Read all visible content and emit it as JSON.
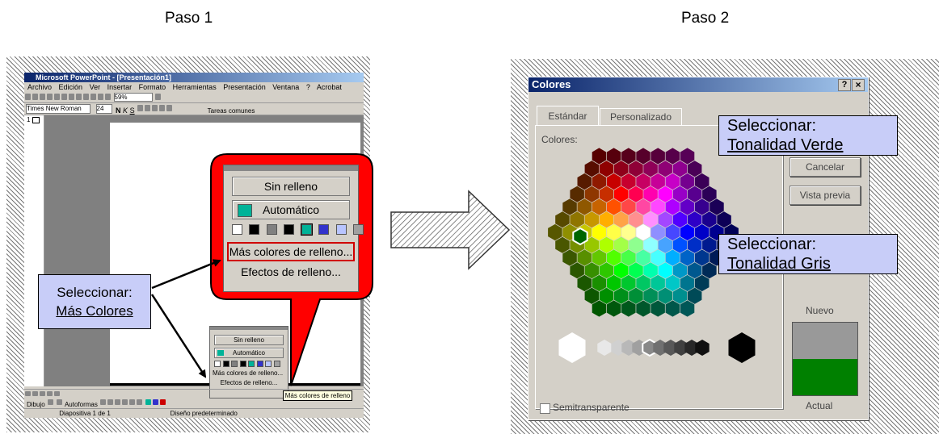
{
  "step1": {
    "heading": "Paso 1",
    "window_title": "Microsoft PowerPoint - [Presentación1]",
    "menu": [
      "Archivo",
      "Edición",
      "Ver",
      "Insertar",
      "Formato",
      "Herramientas",
      "Presentación",
      "Ventana",
      "?",
      "Acrobat"
    ],
    "toolbar": {
      "zoom": "59%",
      "font": "Times New Roman",
      "size": "24",
      "tasks": "Tareas comunes"
    },
    "slide_number": "1",
    "fill_menu": {
      "no_fill": "Sin relleno",
      "automatic": "Automático",
      "more_colors": "Más colores de relleno...",
      "effects": "Efectos de relleno...",
      "swatches": [
        "#ffffff",
        "#000000",
        "#808080",
        "#000000",
        "#00b398",
        "#3333cc",
        "#b8c4ff",
        "#a0a0a0"
      ]
    },
    "tooltip": "Más colores de relleno",
    "drawing_bar": {
      "dibujo": "Dibujo",
      "autoformas": "Autoformas"
    },
    "status_bar": {
      "slide": "Diapositiva 1 de 1",
      "design": "Diseño predeterminado"
    },
    "callout": {
      "line1": "Seleccionar:",
      "line2": "Más Colores"
    }
  },
  "step2": {
    "heading": "Paso 2",
    "dialog_title": "Colores",
    "title_help": "?",
    "title_close": "×",
    "tabs": [
      "Estándar",
      "Personalizado"
    ],
    "colors_label": "Colores:",
    "buttons": {
      "cancel": "Cancelar",
      "preview": "Vista previa"
    },
    "new_label": "Nuevo",
    "current_label": "Actual",
    "semitransparent_label": "Semitransparente",
    "new_color": "#999999",
    "current_color": "#008000",
    "grays": [
      "#ffffff",
      "#e8e8e8",
      "#d0d0d0",
      "#b8b8b8",
      "#a0a0a0",
      "#888888",
      "#707070",
      "#585858",
      "#404040",
      "#282828",
      "#101010",
      "#000000"
    ],
    "callout_green": {
      "line1": "Seleccionar:",
      "line2": "Tonalidad Verde"
    },
    "callout_gray": {
      "line1": "Seleccionar:",
      "line2": "Tonalidad Gris"
    }
  }
}
